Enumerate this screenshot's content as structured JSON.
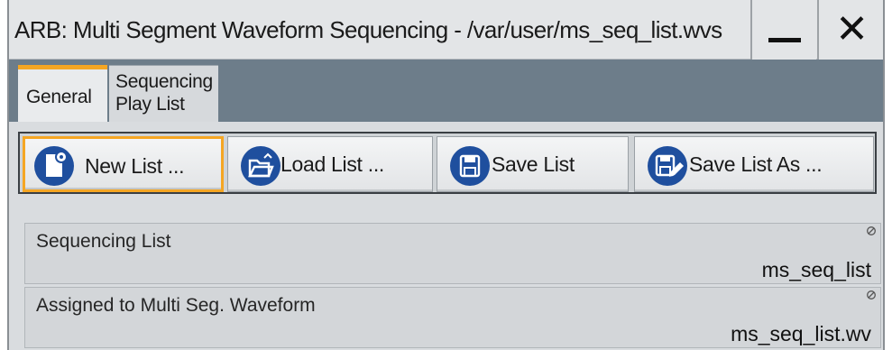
{
  "window": {
    "title": "ARB: Multi Segment Waveform Sequencing - /var/user/ms_seq_list.wvs",
    "close_glyph": "✕"
  },
  "tabs": [
    {
      "label": "General",
      "active": true
    },
    {
      "label": "Sequencing Play List",
      "active": false
    }
  ],
  "toolbar": {
    "buttons": [
      {
        "label": "New List ...",
        "icon": "new-list-icon",
        "focused": true
      },
      {
        "label": "Load List ...",
        "icon": "folder-open-icon",
        "focused": false
      },
      {
        "label": "Save List",
        "icon": "save-icon",
        "focused": false
      },
      {
        "label": "Save List As ...",
        "icon": "save-as-icon",
        "focused": false
      }
    ]
  },
  "fields": [
    {
      "label": "Sequencing List",
      "value": "ms_seq_list"
    },
    {
      "label": "Assigned to Multi Seg. Waveform",
      "value": "ms_seq_list.wv"
    }
  ],
  "colors": {
    "accent": "#f5a623",
    "icon_blue": "#1f4f9e",
    "tabstrip": "#6d7d8a"
  }
}
